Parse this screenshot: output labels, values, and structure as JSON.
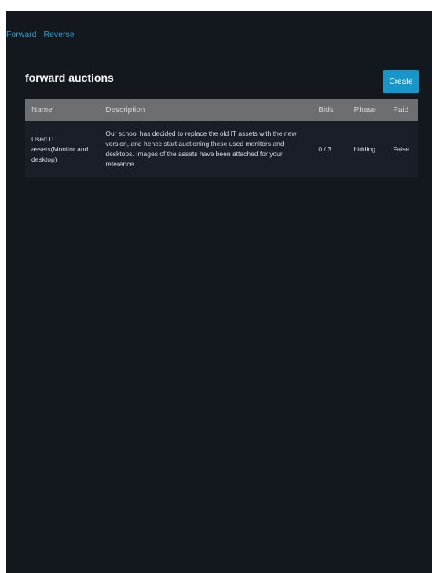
{
  "nav": {
    "links": [
      "Forward",
      "Reverse"
    ]
  },
  "page": {
    "title": "forward auctions",
    "create_label": "Create"
  },
  "table": {
    "headers": [
      "Name",
      "Description",
      "Bids",
      "Phase",
      "Paid"
    ],
    "rows": [
      {
        "name": "Used IT assets(Monitor and desktop)",
        "description": "Our school has decided to replace the old IT assets with the new version, and hence start auctioning these used monitors and desktops. Images of the assets have been attached for your reference.",
        "bids": "0 / 3",
        "phase": "bidding",
        "paid": "False"
      }
    ]
  },
  "colors": {
    "background": "#13171e",
    "accent": "#1597c9",
    "header_row": "#6c6e71",
    "body_row": "#1a1f27"
  }
}
